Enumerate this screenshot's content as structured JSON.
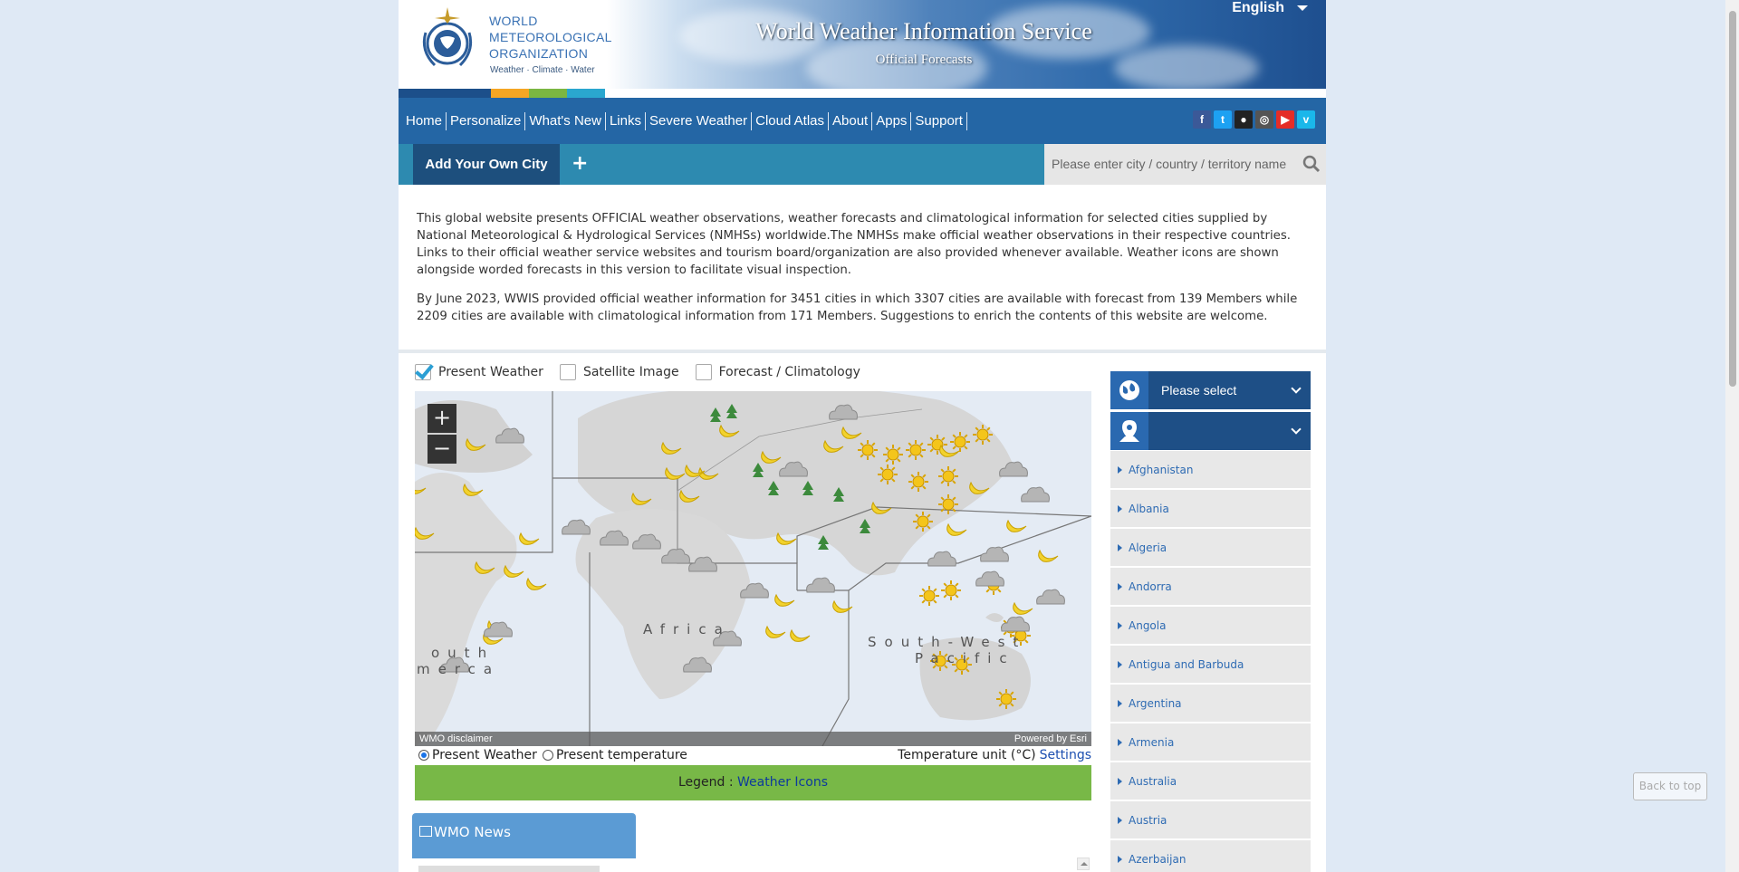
{
  "header": {
    "org_line1": "WORLD",
    "org_line2": "METEOROLOGICAL",
    "org_line3": "ORGANIZATION",
    "tagline": "Weather · Climate · Water",
    "site_title": "World Weather Information Service",
    "site_subtitle": "Official Forecasts",
    "language": "English"
  },
  "colors": {
    "nav": "#2466a5",
    "strip": [
      "#1c4f8a",
      "#f5a623",
      "#7bb642",
      "#2aa7cf"
    ],
    "legend": "#78b847"
  },
  "nav": {
    "items": [
      "Home",
      "Personalize",
      "What's New",
      "Links",
      "Severe Weather",
      "Cloud Atlas",
      "About",
      "Apps",
      "Support"
    ],
    "socials": [
      "facebook-icon",
      "twitter-icon",
      "flickr-icon",
      "instagram-icon",
      "youtube-icon",
      "vimeo-icon"
    ]
  },
  "citybar": {
    "add_city": "Add Your Own City",
    "plus": "+",
    "search_placeholder": "Please enter city / country / territory name"
  },
  "intro": {
    "p1": "This global website presents OFFICIAL weather observations, weather forecasts and climatological information for selected cities supplied by National Meteorological & Hydrological Services (NMHSs) worldwide.The NMHSs make official weather observations in their respective countries. Links to their official weather service websites and tourism board/organization are also provided whenever available. Weather icons are shown alongside worded forecasts in this version to facilitate visual inspection.",
    "p2": "By June 2023, WWIS provided official weather information for 3451 cities in which 3307 cities are available with forecast from 139 Members while 2209 cities are available with climatological information from 171 Members. Suggestions to enrich the contents of this website are welcome."
  },
  "map_panel": {
    "checks": [
      {
        "label": "Present Weather",
        "checked": true
      },
      {
        "label": "Satellite Image",
        "checked": false
      },
      {
        "label": "Forecast / Climatology",
        "checked": false
      }
    ],
    "zoom_in": "+",
    "zoom_out": "−",
    "disclaimer": "WMO disclaimer",
    "powered_by": "Powered by Esri",
    "labels": {
      "africa": "Africa",
      "south_america_1": "outh",
      "south_america_2": "merca",
      "sw_pacific_1": "South-West",
      "sw_pacific_2": "Pacific"
    },
    "radio_present_weather": "Present Weather",
    "radio_present_temperature": "Present temperature",
    "temperature_unit": "Temperature unit (°C)",
    "settings": "Settings",
    "legend_prefix": "Legend :",
    "legend_link": "Weather Icons"
  },
  "news": {
    "tab": "WMO News"
  },
  "sidebar": {
    "region_select": "Please select",
    "country_select": "",
    "countries": [
      "Afghanistan",
      "Albania",
      "Algeria",
      "Andorra",
      "Angola",
      "Antigua and Barbuda",
      "Argentina",
      "Armenia",
      "Australia",
      "Austria",
      "Azerbaijan"
    ]
  },
  "back_to_top": "Back to top"
}
